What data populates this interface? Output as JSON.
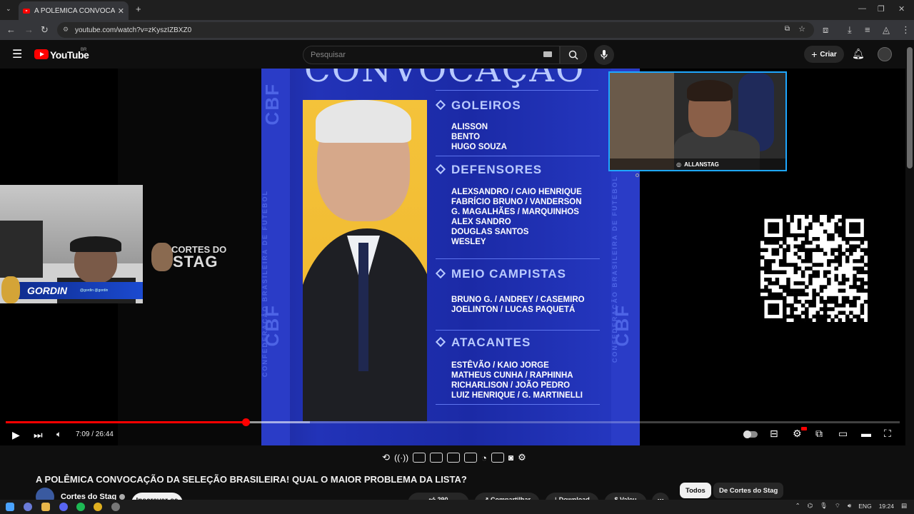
{
  "browser": {
    "tab_title": "A POLÊMICA CONVOCAÇÃO DA",
    "url": "youtube.com/watch?v=zKyszIZBXZ0"
  },
  "youtube": {
    "logo_text": "YouTube",
    "region": "BR",
    "search_placeholder": "Pesquisar",
    "create_label": "Criar"
  },
  "video": {
    "graphic_title": "CONVOCAÇÃO",
    "side_text": "CBF",
    "side_subtext": "CONFEDERAÇÃO BRASILEIRA DE FUTEBOL",
    "sections": [
      {
        "heading": "GOLEIROS",
        "players": [
          "ALISSON",
          "BENTO",
          "HUGO SOUZA"
        ]
      },
      {
        "heading": "DEFENSORES",
        "players": [
          "ALEXSANDRO / CAIO HENRIQUE",
          "FABRÍCIO BRUNO / VANDERSON",
          "G. MAGALHÃES / MARQUINHOS",
          "ALEX SANDRO",
          "DOUGLAS SANTOS",
          "WESLEY"
        ]
      },
      {
        "heading": "MEIO CAMPISTAS",
        "players": [
          "BRUNO G. / ANDREY / CASEMIRO",
          "JOELINTON / LUCAS PAQUETÁ"
        ]
      },
      {
        "heading": "ATACANTES",
        "players": [
          "ESTÊVÃO / KAIO JORGE",
          "MATHEUS CUNHA / RAPHINHA",
          "RICHARLISON / JOÃO PEDRO",
          "LUIZ HENRIQUE / G. MARTINELLI"
        ]
      }
    ],
    "cam_right_tag": "ALLANSTAG",
    "cam_left_name": "GORDIN",
    "cam_left_handles": "@gordin  @gordin",
    "logo_line1": "CORTES DO",
    "logo_line2": "STAG",
    "progress": 0.268,
    "buffered": 0.34,
    "time_label": "7:09 / 26:44"
  },
  "below": {
    "title": "A POLÊMICA CONVOCAÇÃO DA SELEÇÃO BRASILEIRA! QUAL O MAIOR PROBLEMA DA LISTA?",
    "channel": "Cortes do Stag",
    "subscribe": "Inscrever-se",
    "likes": "290",
    "share": "Compartilhar",
    "download": "Download",
    "thanks": "Valeu",
    "chip_all": "Todos",
    "chip_channel": "De Cortes do Stag"
  },
  "taskbar": {
    "lang": "ENG",
    "clock": "19:24"
  },
  "colors": {
    "yt_red": "#ff0000",
    "cbf_blue": "#2233b8"
  }
}
